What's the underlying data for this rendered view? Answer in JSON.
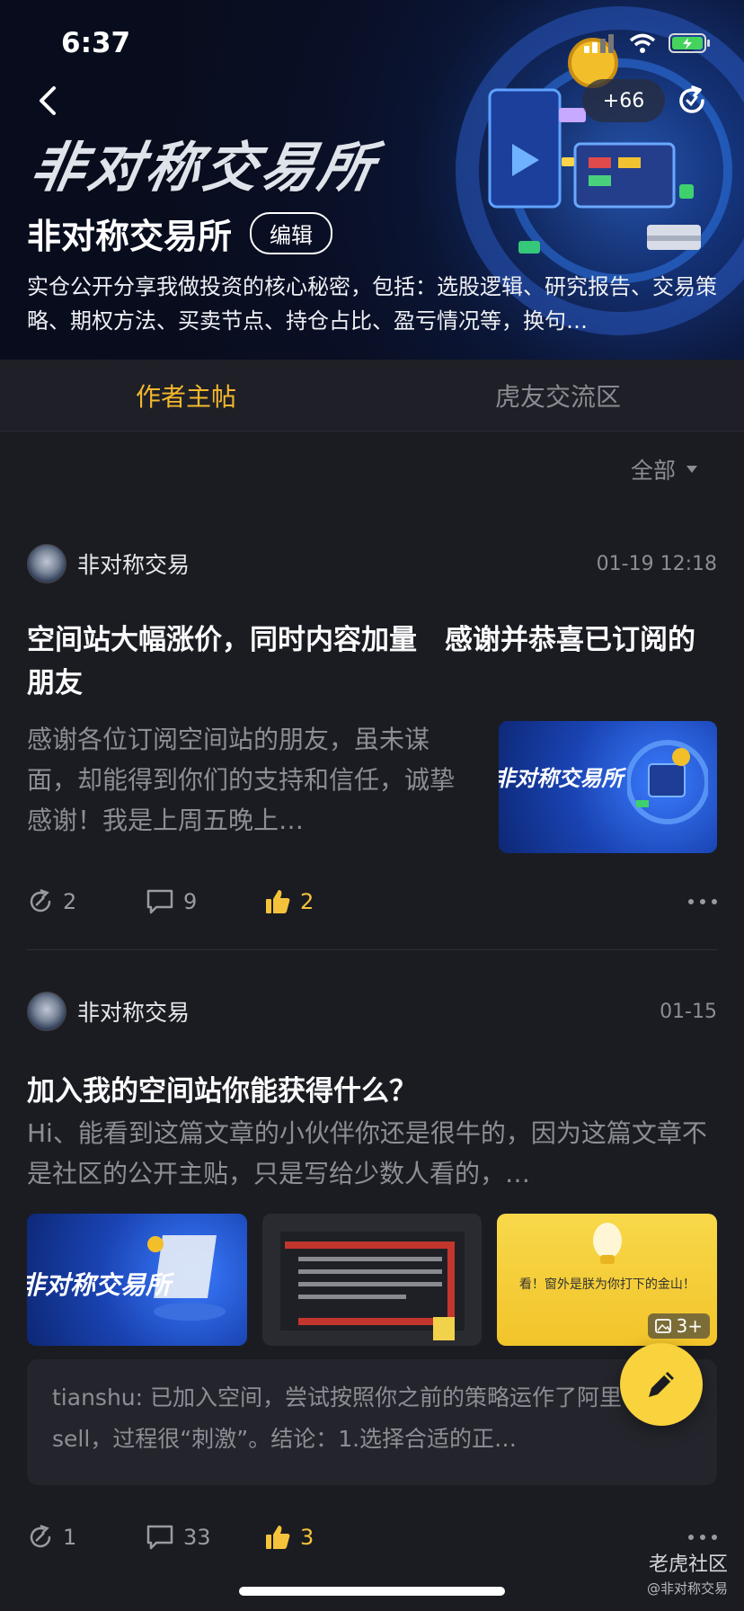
{
  "status_bar": {
    "time": "6:37"
  },
  "header": {
    "banner_word": "非对称交易所",
    "count_badge": "+66",
    "title": "非对称交易所",
    "edit_label": "编辑",
    "description": "实仓公开分享我做投资的核心秘密，包括：选股逻辑、研究报告、交易策略、期权方法、买卖节点、持仓占比、盈亏情况等，换句…"
  },
  "tabs": [
    {
      "label": "作者主帖",
      "active": true
    },
    {
      "label": "虎友交流区",
      "active": false
    }
  ],
  "filter": {
    "label": "全部"
  },
  "posts": [
    {
      "author": "非对称交易",
      "date": "01-19 12:18",
      "title": "空间站大幅涨价，同时内容加量　感谢并恭喜已订阅的朋友",
      "excerpt": "感谢各位订阅空间站的朋友，虽未谋面，却能得到你们的支持和信任，诚挚感谢！我是上周五晚上…",
      "thumbnail_text": "非对称交易所",
      "reposts": "2",
      "comments": "9",
      "likes": "2"
    },
    {
      "author": "非对称交易",
      "date": "01-15",
      "title": "加入我的空间站你能获得什么？",
      "excerpt": "Hi、能看到这篇文章的小伙伴你还是很牛的，因为这篇文章不是社区的公开主贴，只是写给少数人看的，…",
      "images": [
        {
          "text": "非对称交易所"
        },
        {
          "text": ""
        },
        {
          "text": "看！窗外是朕为你打下的金山！"
        }
      ],
      "more_images": "3+",
      "comment_preview": "tianshu: 已加入空间，尝试按照你之前的策略运作了阿里 put sell，过程很“刺激”。结论：1.选择合适的正…",
      "reposts": "1",
      "comments": "33",
      "likes": "3"
    }
  ],
  "watermark": {
    "brand": "老虎社区",
    "handle": "@非对称交易"
  },
  "colors": {
    "accent": "#f5b82e",
    "background": "#1b1c22",
    "fab": "#f8d33d"
  }
}
